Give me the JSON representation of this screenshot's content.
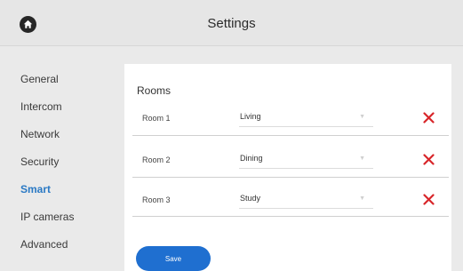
{
  "header": {
    "title": "Settings",
    "home_icon": "home-icon"
  },
  "sidebar": {
    "items": [
      {
        "label": "General"
      },
      {
        "label": "Intercom"
      },
      {
        "label": "Network"
      },
      {
        "label": "Security"
      },
      {
        "label": "Smart",
        "active": true
      },
      {
        "label": "IP cameras"
      },
      {
        "label": "Advanced"
      }
    ]
  },
  "main": {
    "section_title": "Rooms",
    "rooms": [
      {
        "label": "Room 1",
        "value": "Living"
      },
      {
        "label": "Room 2",
        "value": "Dining"
      },
      {
        "label": "Room 3",
        "value": "Study"
      }
    ],
    "save_label": "Save"
  },
  "colors": {
    "accent": "#1f6fd0",
    "active_nav": "#2a79c4",
    "delete": "#d8262a",
    "background": "#eaeaea",
    "panel": "#ffffff"
  }
}
